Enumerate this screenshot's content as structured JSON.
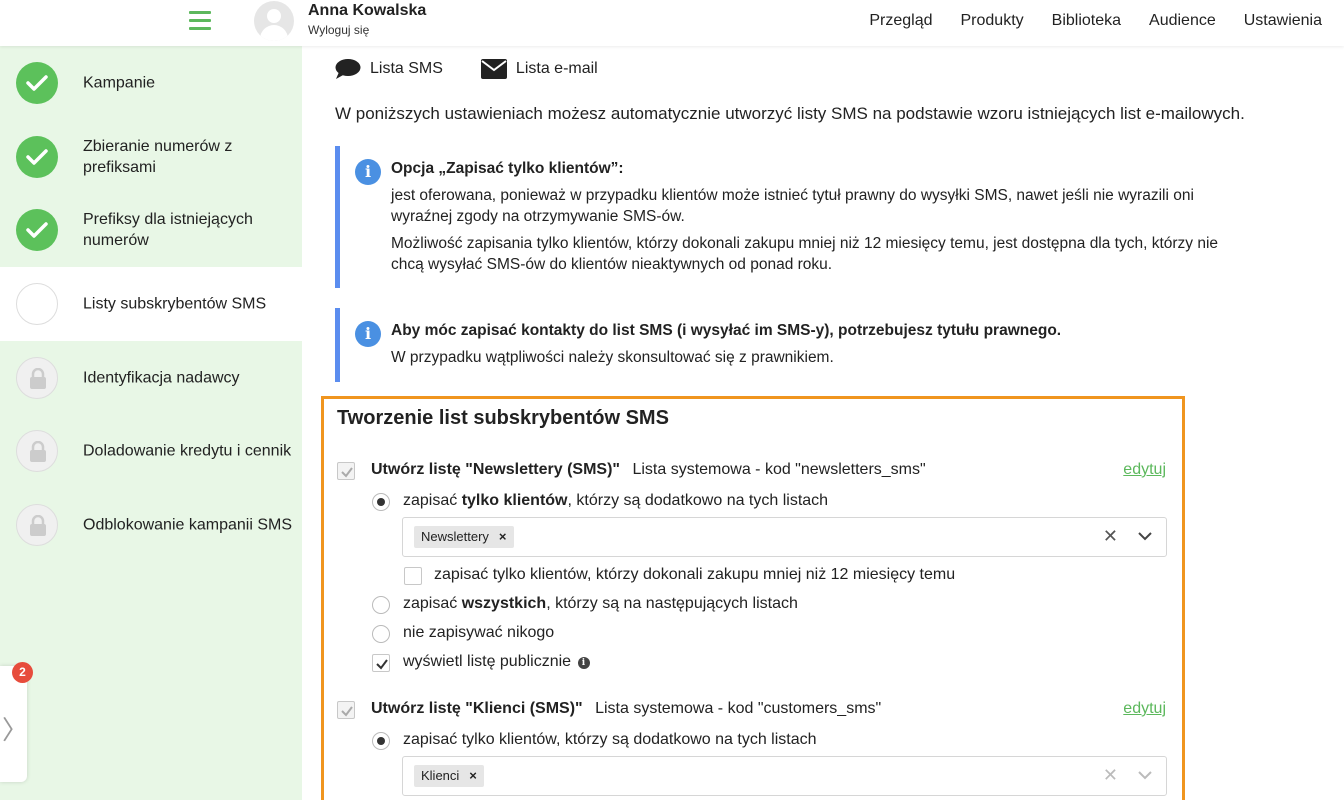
{
  "header": {
    "user_name": "Anna Kowalska",
    "logout_label": "Wyloguj się",
    "nav": [
      "Przegląd",
      "Produkty",
      "Biblioteka",
      "Audience",
      "Ustawienia"
    ]
  },
  "sidebar": {
    "steps": [
      {
        "label": "Kampanie",
        "state": "done"
      },
      {
        "label": "Zbieranie numerów z prefiksami",
        "state": "done"
      },
      {
        "label": "Prefiksy dla istniejących numerów",
        "state": "done"
      },
      {
        "label": "Listy subskrybentów SMS",
        "state": "current"
      },
      {
        "label": "Identyfikacja nadawcy",
        "state": "locked"
      },
      {
        "label": "Doladowanie kredytu i cennik",
        "state": "locked"
      },
      {
        "label": "Odblokowanie kampanii SMS",
        "state": "locked"
      }
    ],
    "notification_count": "2"
  },
  "main": {
    "tabs": [
      {
        "label": "Lista SMS",
        "icon": "chat-bubble-icon"
      },
      {
        "label": "Lista e-mail",
        "icon": "envelope-icon"
      }
    ],
    "intro": "W poniższych ustawieniach możesz automatycznie utworzyć listy SMS na podstawie wzoru istniejących list e-mailowych.",
    "info1": {
      "title": "Opcja „Zapisać tylko klientów”:",
      "line1": "jest oferowana, ponieważ w przypadku klientów może istnieć tytuł prawny do wysyłki SMS, nawet jeśli nie wyrazili oni wyraźnej zgody na otrzymywanie SMS-ów.",
      "line2": "Możliwość zapisania tylko klientów, którzy dokonali zakupu mniej niż 12 miesięcy temu, jest dostępna dla tych, którzy nie chcą wysyłać SMS-ów do klientów nieaktywnych od ponad roku."
    },
    "info2": {
      "title": "Aby móc zapisać kontakty do list SMS (i wysyłać im SMS-y), potrzebujesz tytułu prawnego.",
      "line1": "W przypadku wątpliwości należy skonsultować się z prawnikiem."
    },
    "section": {
      "title": "Tworzenie list subskrybentów SMS",
      "edit_label": "edytuj",
      "list1": {
        "create": "Utwórz listę \"Newslettery (SMS)\"",
        "system": "Lista systemowa - kod \"newsletters_sms\"",
        "opt1_prefix": "zapisać ",
        "opt1_bold": "tylko klientów",
        "opt1_suffix": ", którzy są dodatkowo na tych listach",
        "chip": "Newslettery",
        "recent": "zapisać tylko klientów, którzy dokonali zakupu mniej niż 12 miesięcy temu",
        "opt2_prefix": "zapisać ",
        "opt2_bold": "wszystkich",
        "opt2_suffix": ", którzy są na następujących listach",
        "opt3": "nie zapisywać nikogo",
        "public": "wyświetl listę publicznie"
      },
      "list2": {
        "create": "Utwórz listę \"Klienci (SMS)\"",
        "system": "Lista systemowa - kod \"customers_sms\"",
        "opt1": "zapisać tylko klientów, którzy są dodatkowo na tych listach",
        "chip": "Klienci"
      }
    }
  }
}
